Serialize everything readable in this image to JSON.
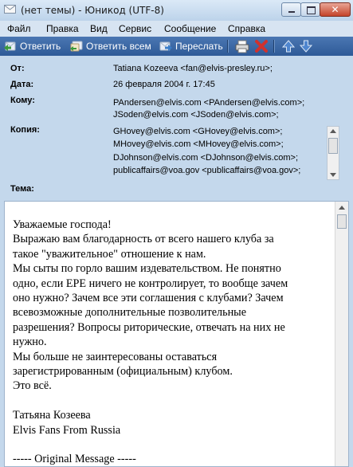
{
  "window": {
    "title": "(нет темы) - Юникод (UTF-8)",
    "close_label": "✕"
  },
  "menu": [
    "Файл",
    "Правка",
    "Вид",
    "Сервис",
    "Сообщение",
    "Справка"
  ],
  "toolbar": {
    "reply": "Ответить",
    "reply_all": "Ответить всем",
    "forward": "Переслать",
    "icons": [
      "print-icon",
      "delete-icon",
      "previous-icon",
      "next-icon"
    ]
  },
  "headers": {
    "from_label": "От:",
    "from_value": "Tatiana Kozeeva <fan@elvis-presley.ru>;",
    "date_label": "Дата:",
    "date_value": "26 февраля 2004 г. 17:45",
    "to_label": "Кому:",
    "to_values": [
      "PAndersen@elvis.com <PAndersen@elvis.com>;",
      "JSoden@elvis.com <JSoden@elvis.com>;"
    ],
    "cc_label": "Копия:",
    "cc_values": [
      "GHovey@elvis.com <GHovey@elvis.com>;",
      "MHovey@elvis.com <MHovey@elvis.com>;",
      "DJohnson@elvis.com <DJohnson@elvis.com>;",
      "publicaffairs@voa.gov <publicaffairs@voa.gov>;"
    ],
    "subject_label": "Тема:",
    "subject_value": ""
  },
  "body": {
    "lines": [
      "Уважаемые господа!",
      "Выражаю вам благодарность от всего нашего клуба за",
      "такое \"уважительное\" отношение к нам.",
      "Мы сыты по горло вашим издевательством. Не понятно",
      "одно, если EPE ничего не контролирует, то вообще зачем",
      "оно нужно? Зачем все эти соглашения с клубами? Зачем",
      "всевозможные дополнительные позволительные",
      "разрешения?  Вопросы риторические, отвечать на них не",
      "нужно.",
      "Мы больше не заинтересованы  оставаться",
      "зарегистрированным (официальным) клубом.",
      "Это всё.",
      "",
      "Татьяна Козеева",
      "Elvis Fans From Russia",
      "",
      "----- Original Message -----"
    ]
  },
  "colors": {
    "window_bg": "#c4d8ec",
    "toolbar_bg": "#3a67a6",
    "close_button": "#c4442a"
  }
}
